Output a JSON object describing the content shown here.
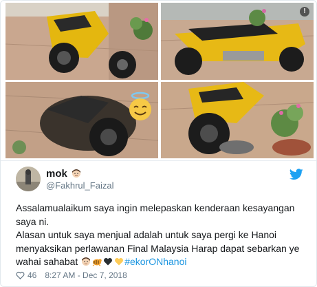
{
  "tweet": {
    "display_name": "mok",
    "handle": "@Fakhrul_Faizal",
    "text_lines": [
      "Assalamualaikum saya ingin melepaskan kenderaan kesayangan saya ni.",
      "Alasan untuk saya menjual adalah untuk saya pergi ke Hanoi menyaksikan perlawanan Final Malaysia Harap dapat sebarkan ye wahai sahabat"
    ],
    "hashtag": "#ekorONhanoi",
    "likes": "46",
    "timestamp": "8:27 AM - Dec 7, 2018",
    "info_badge": "!"
  },
  "icons": {
    "twitter": "twitter-bird-icon",
    "like": "heart-icon",
    "info": "info-icon",
    "name_emoji": "man-face-emoji",
    "text_emojis": [
      "man-face-emoji",
      "tiger-emoji",
      "black-heart-emoji",
      "yellow-heart-emoji"
    ],
    "overlay_emoji": "smiling-face-with-halo-emoji"
  },
  "colors": {
    "accent": "#1da1f2",
    "hashtag": "#1b95e0",
    "muted": "#657786",
    "motorcycle_yellow": "#e7b915"
  }
}
